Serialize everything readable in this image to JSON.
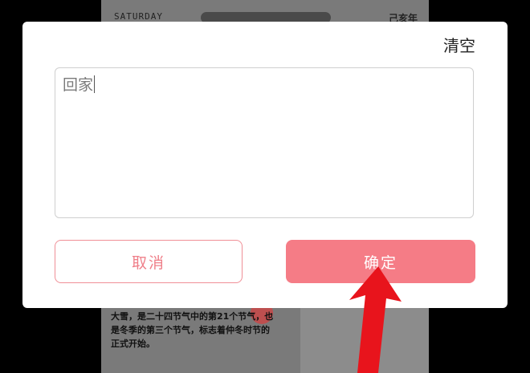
{
  "background": {
    "top_left_text": "SATURDAY",
    "top_right_text": "己亥年",
    "body_text_1": "大雪，是二十四节气中的第21个节气，也",
    "body_text_2": "是冬季的第三个节气，标志着仲冬时节的",
    "body_text_3": "正式开始。"
  },
  "dialog": {
    "clear_label": "清空",
    "input_value": "回家",
    "cancel_label": "取消",
    "confirm_label": "确定"
  },
  "colors": {
    "accent": "#f57c86",
    "accent_border": "#f08f97",
    "arrow": "#e8141c"
  }
}
